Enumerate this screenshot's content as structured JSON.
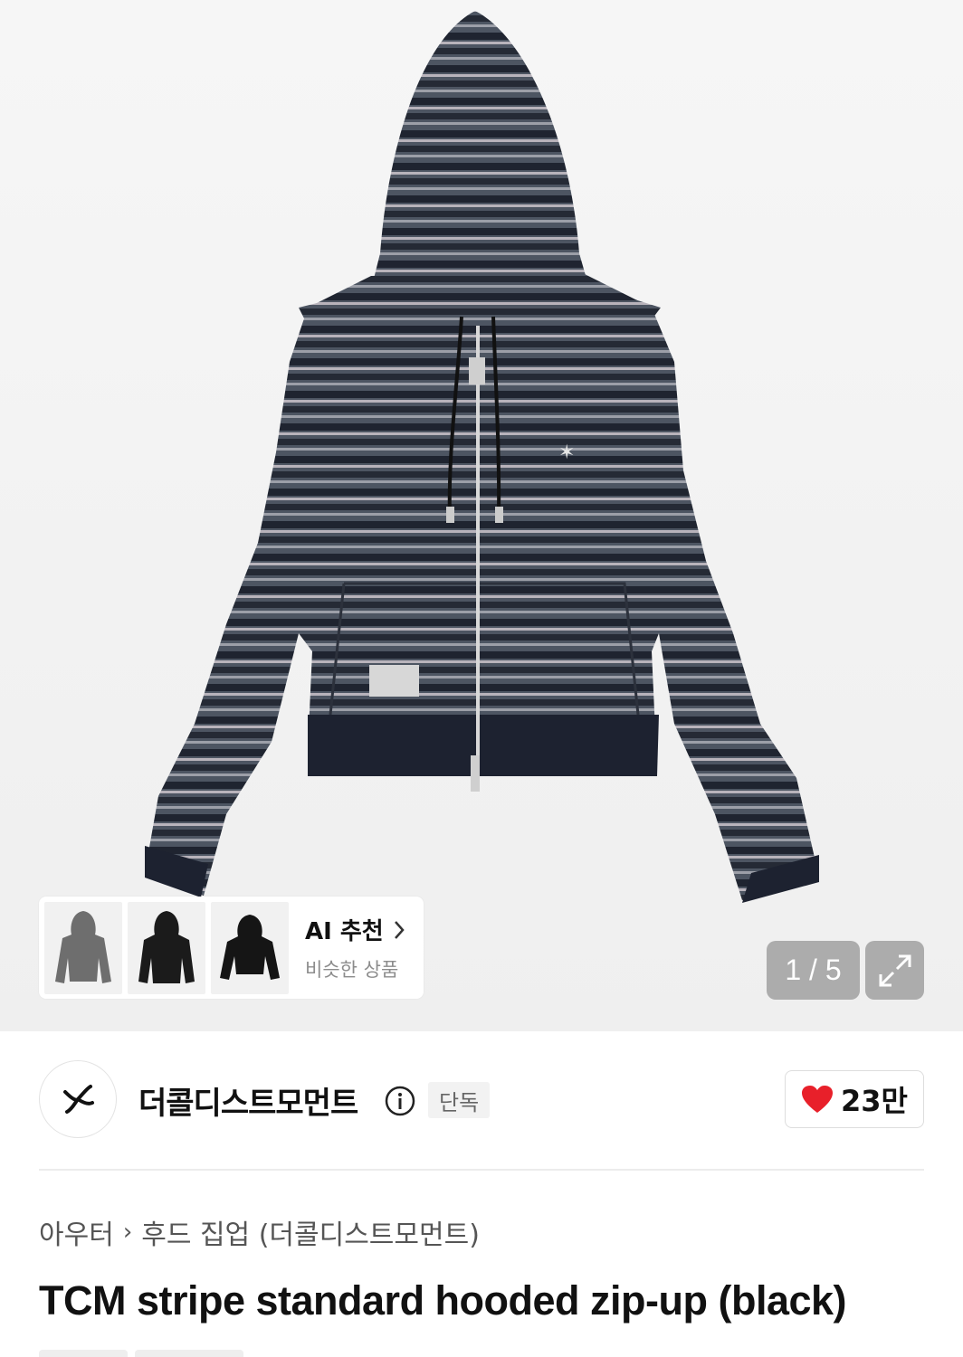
{
  "gallery": {
    "pager_text": "1 / 5",
    "expand_icon": "expand-icon"
  },
  "ai_recommend": {
    "title": "AI 추천",
    "subtitle": "비슷한 상품",
    "chevron_icon": "chevron-right-icon",
    "thumbnails": [
      {
        "name": "gray striped zip hoodie"
      },
      {
        "name": "black hoodie"
      },
      {
        "name": "black zip hoodie"
      }
    ]
  },
  "brand": {
    "name": "더콜디스트모먼트",
    "badge": "단독",
    "info_icon": "info-icon",
    "likes": "23만",
    "like_icon": "heart-icon"
  },
  "breadcrumb": {
    "category": "아우터",
    "subcategory": "후드 집업 (더콜디스트모먼트)"
  },
  "product": {
    "title": "TCM stripe standard hooded zip-up (black)"
  },
  "colors": {
    "heart": "#e8202a",
    "stripe_dark": "#1f2430",
    "stripe_mid": "#4d5562",
    "stripe_light": "#a9a9b1"
  }
}
